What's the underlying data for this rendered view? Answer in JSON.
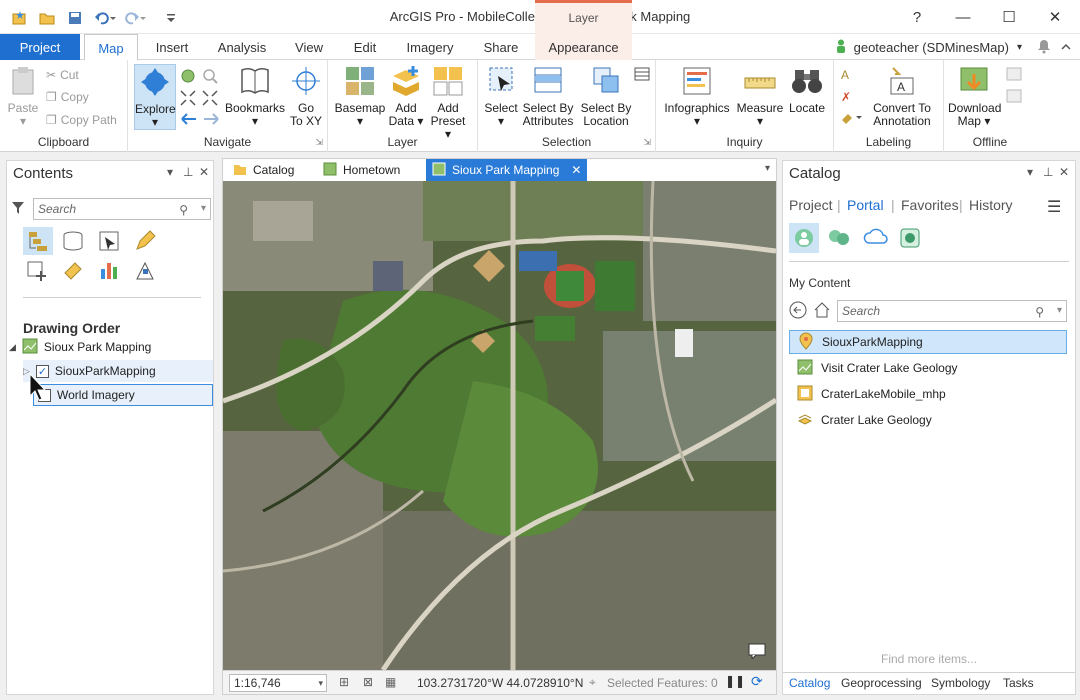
{
  "window": {
    "title": "ArcGIS Pro - MobileCollection - Sioux Park Mapping",
    "context_tab_group": "Layer",
    "help": "?",
    "minimize": "—",
    "maximize": "☐",
    "close": "✕"
  },
  "tabs": {
    "project": "Project",
    "map": "Map",
    "insert": "Insert",
    "analysis": "Analysis",
    "view": "View",
    "edit": "Edit",
    "imagery": "Imagery",
    "share": "Share",
    "appearance": "Appearance"
  },
  "user": {
    "name": "geoteacher (SDMinesMap)",
    "caret": "▾"
  },
  "ribbon": {
    "clipboard": {
      "label": "Clipboard",
      "paste": "Paste",
      "cut": "Cut",
      "copy": "Copy",
      "copy_path": "Copy Path"
    },
    "navigate": {
      "label": "Navigate",
      "explore": "Explore",
      "bookmarks": "Bookmarks",
      "go_to_xy_1": "Go",
      "go_to_xy_2": "To XY"
    },
    "layer": {
      "label": "Layer",
      "basemap": "Basemap",
      "add_data_1": "Add",
      "add_data_2": "Data",
      "add_preset_1": "Add",
      "add_preset_2": "Preset"
    },
    "selection": {
      "label": "Selection",
      "select": "Select",
      "select_by_attr_1": "Select By",
      "select_by_attr_2": "Attributes",
      "select_by_loc_1": "Select By",
      "select_by_loc_2": "Location"
    },
    "inquiry": {
      "label": "Inquiry",
      "infographics": "Infographics",
      "measure": "Measure",
      "locate": "Locate"
    },
    "labeling": {
      "label": "Labeling",
      "convert_1": "Convert To",
      "convert_2": "Annotation"
    },
    "offline": {
      "label": "Offline",
      "download_1": "Download",
      "download_2": "Map"
    }
  },
  "contents": {
    "title": "Contents",
    "search_placeholder": "Search",
    "drawing_order": "Drawing Order",
    "map_name": "Sioux Park Mapping",
    "layers": [
      {
        "name": "SiouxParkMapping"
      },
      {
        "name": "World Imagery"
      }
    ]
  },
  "view_tabs": {
    "catalog": "Catalog",
    "hometown": "Hometown",
    "sioux": "Sioux Park Mapping"
  },
  "status": {
    "scale": "1:16,746",
    "coords": "103.2731720°W 44.0728910°N",
    "selected": "Selected Features: 0"
  },
  "catalog": {
    "title": "Catalog",
    "tabs": {
      "project": "Project",
      "portal": "Portal",
      "favorites": "Favorites",
      "history": "History"
    },
    "section": "My Content",
    "search_placeholder": "Search",
    "items": [
      {
        "name": "SiouxParkMapping"
      },
      {
        "name": "Visit Crater Lake Geology"
      },
      {
        "name": "CraterLakeMobile_mhp"
      },
      {
        "name": "Crater Lake Geology"
      }
    ],
    "find_more": "Find more items...",
    "bottom_tabs": {
      "catalog": "Catalog",
      "geoprocessing": "Geoprocessing",
      "symbology": "Symbology",
      "tasks": "Tasks"
    }
  },
  "colors": {
    "accent": "#1f6fd1",
    "context": "#e36c4a",
    "selection": "#cfe6fb"
  }
}
